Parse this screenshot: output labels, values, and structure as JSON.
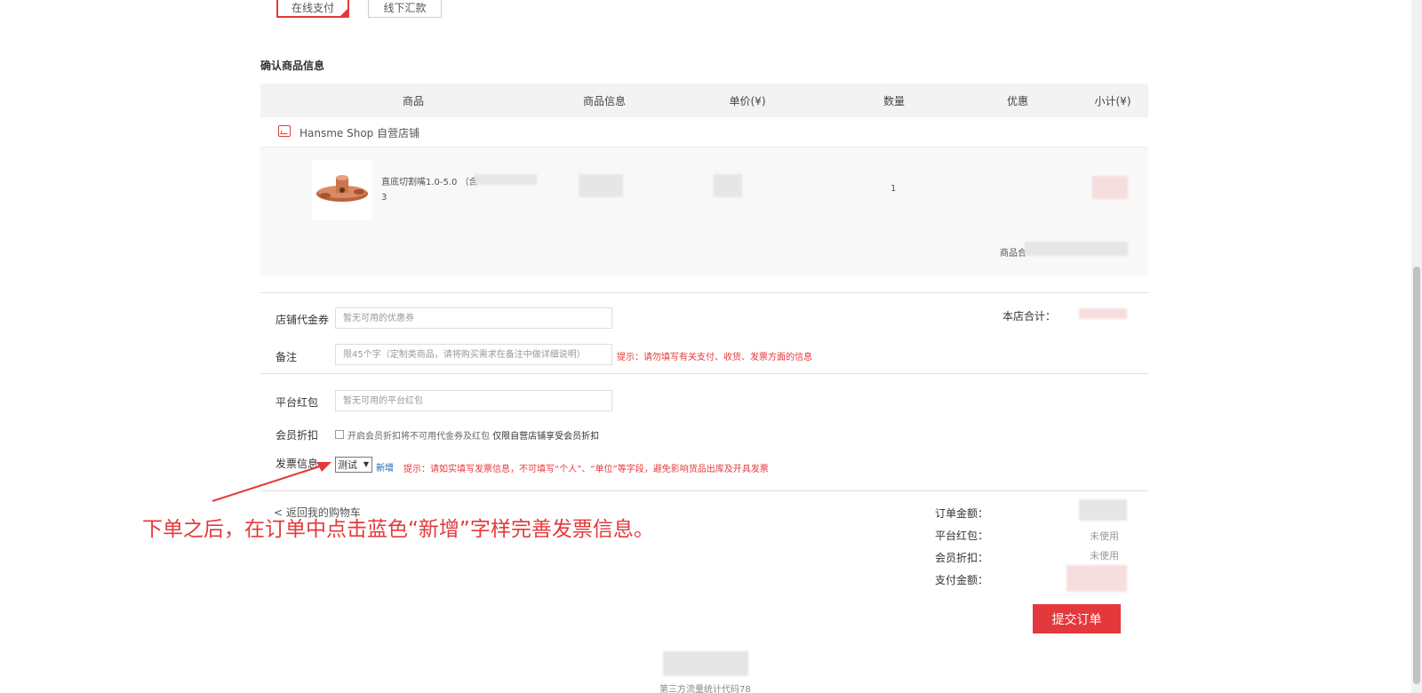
{
  "payment": {
    "online_label": "在线支付",
    "offline_label": "线下汇款"
  },
  "section_title": "确认商品信息",
  "table_headers": [
    "商品",
    "商品信息",
    "单价(¥)",
    "数量",
    "优惠",
    "小计(¥)"
  ],
  "shop": {
    "name": "Hansme Shop 自营店铺",
    "icon": "shop-icon"
  },
  "item": {
    "title": "直底切割嘴1.0-5.0 （含",
    "sub": "3",
    "quantity": "1",
    "subtotal_label": "商品合"
  },
  "store_total_label": "本店合计：",
  "form": {
    "coupon_label": "店铺代金券",
    "coupon_placeholder": "暂无可用的优惠券",
    "remark_label": "备注",
    "remark_placeholder": "限45个字（定制类商品，请将购买需求在备注中做详细说明）",
    "remark_hint": "提示：请勿填写有关支付、收货、发票方面的信息",
    "redpacket_label": "平台红包",
    "redpacket_placeholder": "暂无可用的平台红包",
    "member_label": "会员折扣",
    "member_checkbox_text": "开启会员折扣将不可用代金券及红包",
    "member_checkbox_note": "仅限自营店铺享受会员折扣",
    "invoice_label": "发票信息",
    "invoice_selected": "测试",
    "invoice_add": "新增",
    "invoice_hint": "提示：请如实填写发票信息，不可填写“个人”、“单位”等字段，避免影响货品出库及开具发票"
  },
  "back_link": "返回我的购物车",
  "summary": {
    "order_amount_label": "订单金额：",
    "redpacket_label": "平台红包：",
    "redpacket_value": "未使用",
    "member_label": "会员折扣：",
    "member_value": "未使用",
    "pay_label": "支付金额："
  },
  "submit_label": "提交订单",
  "annotation": "下单之后，在订单中点击蓝色“新增”字样完善发票信息。",
  "footer": "第三方流量统计代码78",
  "colors": {
    "accent": "#e4393c",
    "link": "#1a5fb4"
  }
}
